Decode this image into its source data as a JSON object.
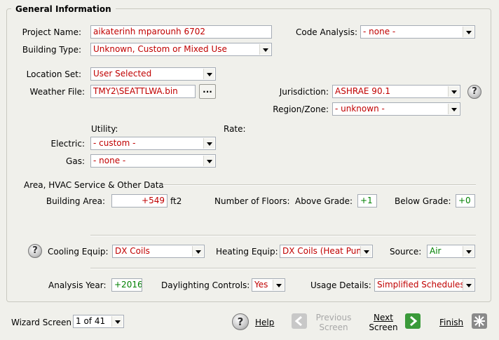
{
  "section": {
    "title": "General Information"
  },
  "project": {
    "label": "Project Name:",
    "value": "aikaterinh mparounh 6702"
  },
  "code_analysis": {
    "label": "Code Analysis:",
    "value": "- none -"
  },
  "building_type": {
    "label": "Building Type:",
    "value": "Unknown, Custom or Mixed Use"
  },
  "location_set": {
    "label": "Location Set:",
    "value": "User Selected"
  },
  "weather_file": {
    "label": "Weather File:",
    "value": "TMY2\\SEATTLWA.bin",
    "browse": "..."
  },
  "jurisdiction": {
    "label": "Jurisdiction:",
    "value": "ASHRAE 90.1"
  },
  "region": {
    "label": "Region/Zone:",
    "value": "- unknown -"
  },
  "utility": {
    "utility_header": "Utility:",
    "rate_header": "Rate:",
    "electric_label": "Electric:",
    "electric_value": "- custom -",
    "gas_label": "Gas:",
    "gas_value": "- none -"
  },
  "area_section": {
    "title": "Area, HVAC Service & Other Data",
    "building_area_label": "Building Area:",
    "building_area_value": "+549",
    "building_area_unit": "ft2",
    "floors_label": "Number of Floors:",
    "above_label": "Above Grade:",
    "above_value": "+1",
    "below_label": "Below Grade:",
    "below_value": "+0"
  },
  "hvac": {
    "cooling_label": "Cooling Equip:",
    "cooling_value": "DX Coils",
    "heating_label": "Heating Equip:",
    "heating_value": "DX Coils (Heat Pum",
    "source_label": "Source:",
    "source_value": "Air"
  },
  "analysis": {
    "year_label": "Analysis Year:",
    "year_value": "+2016",
    "daylight_label": "Daylighting Controls:",
    "daylight_value": "Yes",
    "usage_label": "Usage Details:",
    "usage_value": "Simplified Schedules"
  },
  "footer": {
    "wizard_label": "Wizard Screen",
    "wizard_value": "1 of 41",
    "help": "Help",
    "previous_line1": "Previous",
    "previous_line2": "Screen",
    "next_line1": "Next",
    "next_line2": "Screen",
    "finish": "Finish"
  },
  "colors": {
    "value_red": "#c00000",
    "value_green": "#008000",
    "background": "#f0f0eb",
    "next_arrow": "#3a9a3a"
  }
}
